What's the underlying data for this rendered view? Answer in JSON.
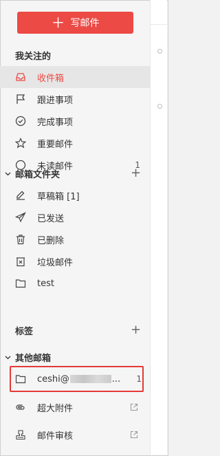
{
  "compose": {
    "label": "写邮件"
  },
  "favorites": {
    "title": "我关注的",
    "items": [
      {
        "label": "收件箱",
        "icon": "inbox-icon",
        "active": true
      },
      {
        "label": "跟进事项",
        "icon": "flag-icon"
      },
      {
        "label": "完成事项",
        "icon": "check-circle-icon"
      },
      {
        "label": "重要邮件",
        "icon": "star-icon"
      },
      {
        "label": "未读邮件",
        "icon": "circle-icon",
        "count": "1"
      }
    ]
  },
  "folders": {
    "title": "邮箱文件夹",
    "items": [
      {
        "label": "草稿箱 [1]",
        "icon": "draft-icon"
      },
      {
        "label": "已发送",
        "icon": "send-icon"
      },
      {
        "label": "已删除",
        "icon": "trash-icon"
      },
      {
        "label": "垃圾邮件",
        "icon": "spam-icon"
      },
      {
        "label": "test",
        "icon": "folder-icon"
      }
    ]
  },
  "tags": {
    "title": "标签"
  },
  "other_mailboxes": {
    "title": "其他邮箱",
    "account": {
      "prefix": "ceshi@",
      "suffix": "...",
      "count": "1",
      "icon": "folder-icon"
    }
  },
  "extras": [
    {
      "label": "超大附件",
      "icon": "attachment-icon"
    },
    {
      "label": "邮件审核",
      "icon": "review-icon"
    }
  ],
  "colors": {
    "accent": "#ec4a45",
    "highlight_border": "#e53935"
  }
}
